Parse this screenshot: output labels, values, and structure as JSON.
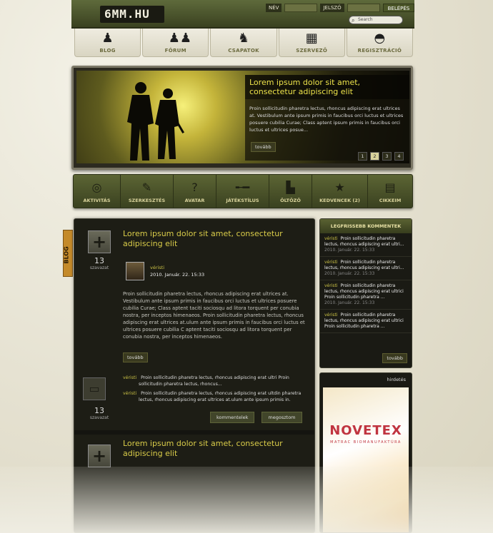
{
  "header": {
    "logo": "6MM.HU",
    "login": {
      "name_label": "NÉV",
      "password_label": "JELSZÓ",
      "login_button": "BELÉPÉS"
    },
    "search": {
      "placeholder": "Search"
    }
  },
  "top_nav": [
    {
      "label": "BLOG",
      "icon": "soldier-icon"
    },
    {
      "label": "FÓRUM",
      "icon": "soldiers-icon"
    },
    {
      "label": "CSAPATOK",
      "icon": "team-icon"
    },
    {
      "label": "SZERVEZŐ",
      "icon": "calendar-icon"
    },
    {
      "label": "REGISZTRÁCIÓ",
      "icon": "helmet-icon"
    }
  ],
  "hero": {
    "title": "Lorem ipsum dolor sit amet, consectetur adipiscing elit",
    "text": "Proin sollicitudin pharetra lectus, rhoncus adipiscing erat ultrices at. Vestibulum ante ipsum primis in faucibus orci luctus et ultrices posuere cubilia Curae; Class aptent ipsum primis in faucibus orci luctus et ultrices posue...",
    "more": "tovább",
    "pages": [
      "1",
      "2",
      "3",
      "4"
    ],
    "active_page": "2"
  },
  "categories": [
    {
      "label": "AKTIVITÁS",
      "icon": "target-icon"
    },
    {
      "label": "SZERKESZTÉS",
      "icon": "pencil-icon"
    },
    {
      "label": "AVATAR",
      "icon": "question-icon"
    },
    {
      "label": "JÁTÉKSTÍLUS",
      "icon": "rifle-icon"
    },
    {
      "label": "ÖLTÖZŐ",
      "icon": "boots-icon"
    },
    {
      "label": "KEDVENCEK (2)",
      "icon": "star-icon"
    },
    {
      "label": "CIKKEIM",
      "icon": "document-icon"
    }
  ],
  "blog_tab": "BLOG",
  "post": {
    "title": "Lorem ipsum dolor sit amet, consectetur adipiscing elit",
    "votes": "13",
    "votes_label": "szavazat",
    "author": "véristi",
    "date": "2010. Január. 22. 15:33",
    "body": "Proin sollicitudin pharetra lectus, rhoncus adipiscing erat ultrices at. Vestibulum ante ipsum primis in faucibus orci luctus et ultrices posuere cubilia Curae; Class aptent taciti sociosqu ad litora torquent per conubia nostra, per inceptos himenaeos. Proin sollicitudin pharetra lectus, rhoncus adipiscing erat ultrices at.ulum ante ipsum primis in faucibus orci luctus et ultrices posuere cubilia C aptent taciti sociosqu ad litora torquent per conubia nostra, per inceptos himenaeos.",
    "more": "tovább",
    "comment_votes": "13",
    "comments": [
      {
        "author": "véristi",
        "text": "Proin sollicitudin pharetra lectus, rhoncus adipiscing erat ultri Proin sollicitudin pharetra lectus, rhoncus..."
      },
      {
        "author": "véristi",
        "text": "Proin sollicitudin pharetra lectus, rhoncus adipiscing erat ultdin pharetra lectus, rhoncus adipiscing erat ultrices at.ulum ante ipsum primis in."
      }
    ],
    "comments_button": "kommentelek",
    "favorite_button": "megosztom"
  },
  "post2": {
    "title": "Lorem ipsum dolor sit amet, consectetur adipiscing elit"
  },
  "sidebar": {
    "heading": "LEGFRISSEBB KOMMENTEK",
    "items": [
      {
        "author": "véristi",
        "text": "Proin sollicitudin pharetra lectus, rhoncus adipiscing erat ultri...",
        "date": "2010. Január. 22. 15:33"
      },
      {
        "author": "véristi",
        "text": "Proin sollicitudin pharetra lectus, rhoncus adipiscing erat ultri...",
        "date": "2010. Január. 22. 15:33"
      },
      {
        "author": "véristi",
        "text": "Proin sollicitudin pharetra lectus, rhoncus adipiscing erat ultrici Proin sollicitudin pharetra ...",
        "date": "2010. Január. 22. 15:33"
      },
      {
        "author": "véristi",
        "text": "Proin sollicitudin pharetra lectus, rhoncus adipiscing erat ultrici Proin sollicitudin pharetra ...",
        "date": "2010. Január. 22. 15:33"
      }
    ],
    "more": "tovább"
  },
  "ad": {
    "heading": "hirdetés",
    "brand": "NOVETEX",
    "subtitle": "MATRAC BIOMANUFAKTÚRA"
  }
}
